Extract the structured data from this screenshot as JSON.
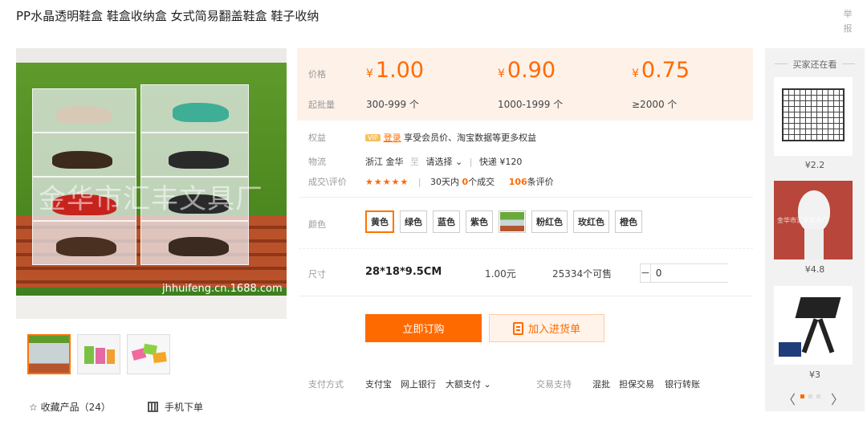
{
  "product": {
    "title": "PP水晶透明鞋盒 鞋盒收纳盒 女式简易翻盖鞋盒 鞋子收纳",
    "report": "举报"
  },
  "gallery": {
    "watermark": "金华市汇丰文具厂",
    "url": "jhhuifeng.cn.1688.com",
    "thumbnails": [
      "thumb-1",
      "thumb-2",
      "thumb-3"
    ]
  },
  "actions": {
    "favorite": "☆ 收藏产品（24）",
    "mobile": "手机下单"
  },
  "pricing": {
    "price_label": "价格",
    "qty_label": "起批量",
    "currency": "¥",
    "tiers": [
      {
        "price": "1.00",
        "range": "300-999 个"
      },
      {
        "price": "0.90",
        "range": "1000-1999 个"
      },
      {
        "price": "0.75",
        "range": "≥2000 个"
      }
    ]
  },
  "benefits": {
    "label": "权益",
    "vip": "VIP",
    "login": "登录",
    "text": " 享受会员价、淘宝数据等更多权益"
  },
  "logistics": {
    "label": "物流",
    "from": "浙江 金华",
    "to": "至",
    "select": "请选择 ⌄",
    "shipping": "快递 ¥120"
  },
  "deals": {
    "label": "成交\\评价",
    "stars": "★★★★★",
    "deals_prefix": "30天内 ",
    "deals_count": "0",
    "deals_suffix": "个成交",
    "reviews_count": "106",
    "reviews_suffix": "条评价"
  },
  "colors": {
    "label": "颜色",
    "options": [
      "黄色",
      "绿色",
      "蓝色",
      "紫色",
      "",
      "粉红色",
      "玫红色",
      "橙色"
    ],
    "selected": "黄色"
  },
  "size": {
    "label": "尺寸",
    "name": "28*18*9.5CM",
    "price": "1.00元",
    "stock": "25334个可售",
    "quantity": "0",
    "minus": "−",
    "plus": "+"
  },
  "buttons": {
    "order": "立即订购",
    "cart": "加入进货单"
  },
  "payment": {
    "label": "支付方式",
    "methods": [
      "支付宝",
      "网上银行",
      "大额支付 ⌄"
    ],
    "trade_label": "交易支持",
    "trade": [
      "混批",
      "担保交易",
      "银行转账"
    ]
  },
  "recommend": {
    "title": "买家还在看",
    "items": [
      {
        "price": "¥2.2",
        "name": "wire-grid"
      },
      {
        "price": "¥4.8",
        "name": "mannequin-head",
        "watermark": "金华市汇丰文具厂"
      },
      {
        "price": "¥3",
        "name": "laptop-stand"
      }
    ],
    "prev": "〈",
    "next": "〉"
  }
}
